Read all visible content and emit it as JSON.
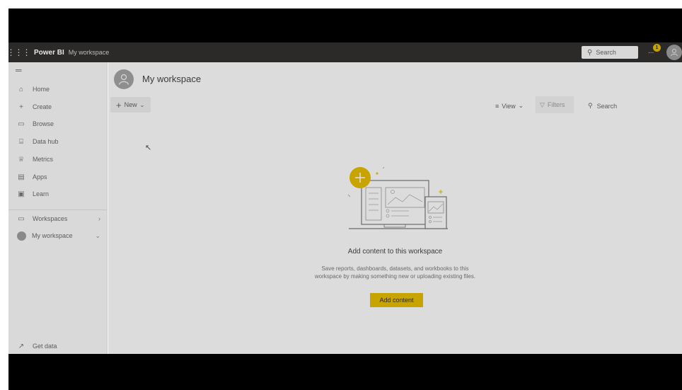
{
  "topbar": {
    "app_name": "Power BI",
    "breadcrumb": "My workspace",
    "search_placeholder": "Search",
    "notification_count": "1",
    "more_label": "...",
    "icons": {
      "waffle": "waffle-icon",
      "search": "search-icon",
      "avatar": "user-avatar-icon"
    },
    "colors": {
      "bar": "#2b2a28",
      "badge": "#c9a400"
    }
  },
  "sidebar": {
    "items": [
      {
        "label": "Home",
        "icon": "home-icon",
        "glyph": "⌂"
      },
      {
        "label": "Create",
        "icon": "plus-icon",
        "glyph": "+"
      },
      {
        "label": "Browse",
        "icon": "folder-icon",
        "glyph": "▭"
      },
      {
        "label": "Data hub",
        "icon": "database-icon",
        "glyph": "⌸"
      },
      {
        "label": "Metrics",
        "icon": "trophy-icon",
        "glyph": "♕"
      },
      {
        "label": "Apps",
        "icon": "apps-icon",
        "glyph": "▤"
      },
      {
        "label": "Learn",
        "icon": "book-icon",
        "glyph": "▣"
      }
    ],
    "workspaces_label": "Workspaces",
    "my_workspace_label": "My workspace",
    "get_data_label": "Get data"
  },
  "main": {
    "title": "My workspace",
    "new_label": "New",
    "view_label": "View",
    "filters_label": "Filters",
    "search_label": "Search",
    "empty_title": "Add content to this workspace",
    "empty_desc_line1": "Save reports, dashboards, datasets, and workbooks to this",
    "empty_desc_line2": "workspace by making something new or uploading existing files.",
    "add_content_label": "Add content",
    "colors": {
      "accent": "#c7a400",
      "background": "#dcdcdc"
    }
  }
}
